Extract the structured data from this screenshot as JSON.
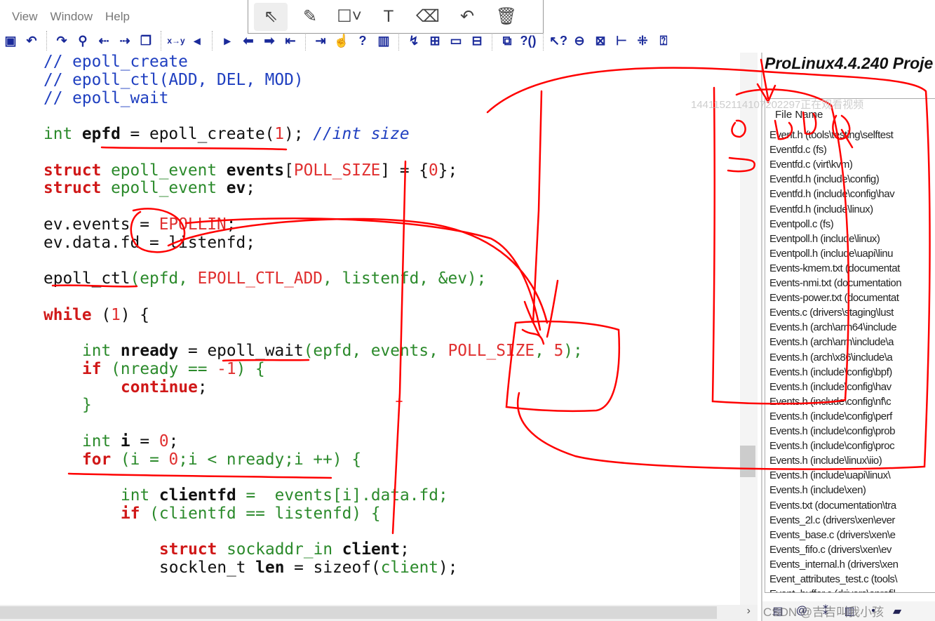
{
  "menu": [
    "View",
    "Window",
    "Help"
  ],
  "toolbar_icons": [
    "save-icon",
    "undo-icon",
    "redo-icon",
    "find-icon",
    "find-prev-icon",
    "find-next-icon",
    "find-files-icon",
    "replace-icon",
    "bookmark-prev-icon",
    "bookmark-next-icon",
    "back-icon",
    "forward-icon",
    "outdent-icon",
    "indent-icon",
    "hand-icon",
    "help-symbol-icon",
    "book-icon",
    "jump-icon",
    "grid-icon",
    "window-icon",
    "split-icon",
    "cascade-icon",
    "context-help-icon",
    "pointer-help-icon",
    "sync-icon",
    "relation-icon",
    "tree-icon",
    "hierarchy-icon",
    "project-help-icon"
  ],
  "annotation_tools": [
    {
      "icon": "select-arrow-icon",
      "glyph": "⇖"
    },
    {
      "icon": "pen-icon",
      "glyph": "✎"
    },
    {
      "icon": "rectangle-icon",
      "glyph": "☐˅"
    },
    {
      "icon": "text-icon",
      "glyph": "T"
    },
    {
      "icon": "eraser-icon",
      "glyph": "⌫"
    },
    {
      "icon": "undo-icon",
      "glyph": "↶"
    },
    {
      "icon": "delete-icon",
      "glyph": "🗑"
    }
  ],
  "code": [
    {
      "indent": 0,
      "tokens": [
        [
          "// epoll_create",
          "cm"
        ]
      ]
    },
    {
      "indent": 0,
      "tokens": [
        [
          "// epoll_ctl(ADD, DEL, MOD)",
          "cm"
        ]
      ]
    },
    {
      "indent": 0,
      "tokens": [
        [
          "// epoll_wait",
          "cm"
        ]
      ]
    },
    {
      "indent": 0,
      "tokens": []
    },
    {
      "indent": 0,
      "tokens": [
        [
          "int ",
          "kw"
        ],
        [
          "epfd",
          "idb"
        ],
        [
          " = epoll_create(",
          "id"
        ],
        [
          "1",
          "num"
        ],
        [
          "); ",
          "id"
        ],
        [
          "//int size",
          "ic"
        ]
      ]
    },
    {
      "indent": 0,
      "tokens": []
    },
    {
      "indent": 0,
      "tokens": [
        [
          "struct ",
          "kwb"
        ],
        [
          "epoll_event ",
          "kw"
        ],
        [
          "events",
          "idb"
        ],
        [
          "[",
          "id"
        ],
        [
          "POLL_SIZE",
          "cst"
        ],
        [
          "] = {",
          "id"
        ],
        [
          "0",
          "num"
        ],
        [
          "};",
          "id"
        ]
      ]
    },
    {
      "indent": 0,
      "tokens": [
        [
          "struct ",
          "kwb"
        ],
        [
          "epoll_event ",
          "kw"
        ],
        [
          "ev",
          "idb"
        ],
        [
          ";",
          "id"
        ]
      ]
    },
    {
      "indent": 0,
      "tokens": []
    },
    {
      "indent": 0,
      "tokens": [
        [
          "ev.events = ",
          "id"
        ],
        [
          "EPOLLIN",
          "cst"
        ],
        [
          ";",
          "id"
        ]
      ]
    },
    {
      "indent": 0,
      "tokens": [
        [
          "ev.data.fd = listenfd;",
          "id"
        ]
      ]
    },
    {
      "indent": 0,
      "tokens": []
    },
    {
      "indent": 0,
      "tokens": [
        [
          "epoll_ctl",
          "fn"
        ],
        [
          "(epfd, ",
          "v"
        ],
        [
          "EPOLL_CTL_ADD",
          "cst"
        ],
        [
          ", listenfd, &ev);",
          "v"
        ]
      ]
    },
    {
      "indent": 0,
      "tokens": []
    },
    {
      "indent": 0,
      "tokens": [
        [
          "while",
          "kwb"
        ],
        [
          " (",
          "id"
        ],
        [
          "1",
          "num"
        ],
        [
          ") {",
          "id"
        ]
      ]
    },
    {
      "indent": 0,
      "tokens": []
    },
    {
      "indent": 1,
      "tokens": [
        [
          "int ",
          "kw"
        ],
        [
          "nready",
          "idb"
        ],
        [
          " = epoll_wait",
          "id"
        ],
        [
          "(epfd, events, ",
          "v"
        ],
        [
          "POLL_SIZE",
          "cst"
        ],
        [
          ", ",
          "v"
        ],
        [
          "5",
          "num"
        ],
        [
          ");",
          "v"
        ]
      ]
    },
    {
      "indent": 1,
      "tokens": [
        [
          "if",
          "kwb"
        ],
        [
          " (nready == ",
          "v"
        ],
        [
          "-1",
          "num"
        ],
        [
          ") {",
          "v"
        ]
      ]
    },
    {
      "indent": 2,
      "tokens": [
        [
          "continue",
          "kwb"
        ],
        [
          ";",
          "id"
        ]
      ]
    },
    {
      "indent": 1,
      "tokens": [
        [
          "}",
          "v"
        ]
      ]
    },
    {
      "indent": 0,
      "tokens": []
    },
    {
      "indent": 1,
      "tokens": [
        [
          "int ",
          "kw"
        ],
        [
          "i",
          "idb"
        ],
        [
          " = ",
          "id"
        ],
        [
          "0",
          "num"
        ],
        [
          ";",
          "id"
        ]
      ]
    },
    {
      "indent": 1,
      "tokens": [
        [
          "for",
          "kwb"
        ],
        [
          " (i = ",
          "v"
        ],
        [
          "0",
          "num"
        ],
        [
          ";i < nready;i ++) {",
          "v"
        ]
      ]
    },
    {
      "indent": 0,
      "tokens": []
    },
    {
      "indent": 2,
      "tokens": [
        [
          "int ",
          "kw"
        ],
        [
          "clientfd",
          "idb"
        ],
        [
          " =  events[i].data.fd;",
          "v"
        ]
      ]
    },
    {
      "indent": 2,
      "tokens": [
        [
          "if",
          "kwb"
        ],
        [
          " (clientfd == listenfd) {",
          "v"
        ]
      ]
    },
    {
      "indent": 0,
      "tokens": []
    },
    {
      "indent": 3,
      "tokens": [
        [
          "struct ",
          "kwb"
        ],
        [
          "sockaddr_in ",
          "kw"
        ],
        [
          "client",
          "idb"
        ],
        [
          ";",
          "id"
        ]
      ]
    },
    {
      "indent": 3,
      "tokens": [
        [
          "socklen_t ",
          "id"
        ],
        [
          "len",
          "idb"
        ],
        [
          " = sizeof(",
          "id"
        ],
        [
          "client",
          "v"
        ],
        [
          ");",
          "id"
        ]
      ]
    }
  ],
  "panel": {
    "title": "ProLinux4.4.240 Proje",
    "header": "File Name",
    "files": [
      "Event.h (tools\\testing\\selftest",
      "Eventfd.c (fs)",
      "Eventfd.c (virt\\kvm)",
      "Eventfd.h (include\\config)",
      "Eventfd.h (include\\config\\hav",
      "Eventfd.h (include\\linux)",
      "Eventpoll.c (fs)",
      "Eventpoll.h (include\\linux)",
      "Eventpoll.h (include\\uapi\\linu",
      "Events-kmem.txt (documentat",
      "Events-nmi.txt (documentation",
      "Events-power.txt (documentat",
      "Events.c (drivers\\staging\\lust",
      "Events.h (arch\\arm64\\include",
      "Events.h (arch\\arm\\include\\a",
      "Events.h (arch\\x86\\include\\a",
      "Events.h (include\\config\\bpf)",
      "Events.h (include\\config\\hav",
      "Events.h (include\\config\\nf\\c",
      "Events.h (include\\config\\perf",
      "Events.h (include\\config\\prob",
      "Events.h (include\\config\\proc",
      "Events.h (include\\linux\\iio)",
      "Events.h (include\\uapi\\linux\\",
      "Events.h (include\\xen)",
      "Events.txt (documentation\\tra",
      "Events_2l.c (drivers\\xen\\ever",
      "Events_base.c (drivers\\xen\\e",
      "Events_fifo.c (drivers\\xen\\ev",
      "Events_internal.h (drivers\\xen",
      "Event_attributes_test.c (tools\\",
      "Event_buffer.c (drivers\\oprofil"
    ]
  },
  "watermark": "1441152114107202297正在观看视频",
  "csdn_watermark": "CSDN @吉吉叫我小孩",
  "annotation_color": "#ff0000"
}
